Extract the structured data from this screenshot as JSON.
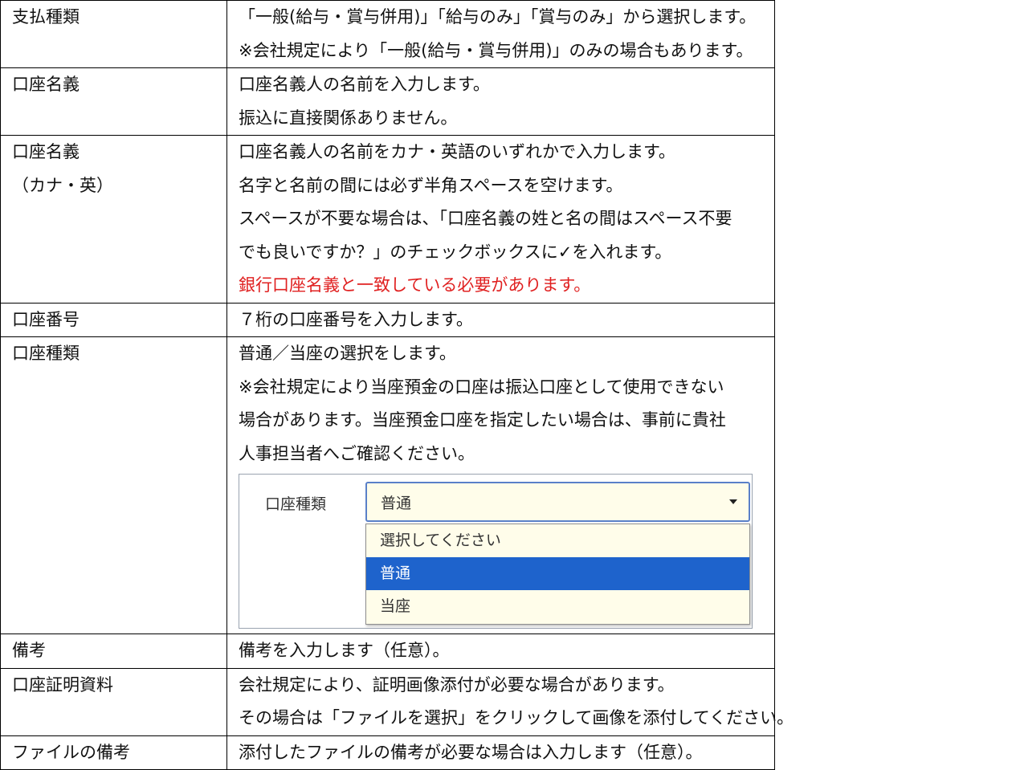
{
  "rows": [
    {
      "label": [
        "支払種類"
      ],
      "lines": [
        "「一般(給与・賞与併用)」「給与のみ」「賞与のみ」から選択します。",
        "※会社規定により「一般(給与・賞与併用)」のみの場合もあります。"
      ]
    },
    {
      "label": [
        "口座名義"
      ],
      "lines": [
        "口座名義人の名前を入力します。",
        "振込に直接関係ありません。"
      ]
    },
    {
      "label": [
        "口座名義",
        "（カナ・英）"
      ],
      "lines": [
        "口座名義人の名前をカナ・英語のいずれかで入力します。",
        "名字と名前の間には必ず半角スペースを空けます。",
        "スペースが不要な場合は、「口座名義の姓と名の間はスペース不要",
        "でも良いですか？」のチェックボックスに✓を入れます。"
      ],
      "warning": "銀行口座名義と一致している必要があります。"
    },
    {
      "label": [
        "口座番号"
      ],
      "lines": [
        "７桁の口座番号を入力します。"
      ]
    },
    {
      "label": [
        "口座種類"
      ],
      "lines": [
        "普通／当座の選択をします。",
        "※会社規定により当座預金の口座は振込口座として使用できない",
        "場合があります。当座預金口座を指定したい場合は、事前に貴社",
        "人事担当者へご確認ください。"
      ],
      "screenshot": {
        "field_label": "口座種類",
        "selected_value": "普通",
        "options": [
          "選択してください",
          "普通",
          "当座"
        ],
        "highlighted_option": "普通",
        "highlight_color": "#1e63cc",
        "field_bg": "#fffdea"
      }
    },
    {
      "label": [
        "備考"
      ],
      "lines": [
        "備考を入力します（任意）。"
      ]
    },
    {
      "label": [
        "口座証明資料"
      ],
      "lines": [
        "会社規定により、証明画像添付が必要な場合があります。",
        "その場合は「ファイルを選択」をクリックして画像を添付してください。"
      ]
    },
    {
      "label": [
        "ファイルの備考"
      ],
      "lines": [
        "添付したファイルの備考が必要な場合は入力します（任意）。"
      ]
    }
  ],
  "colors": {
    "warning": "#e02020",
    "border": "#000000"
  }
}
